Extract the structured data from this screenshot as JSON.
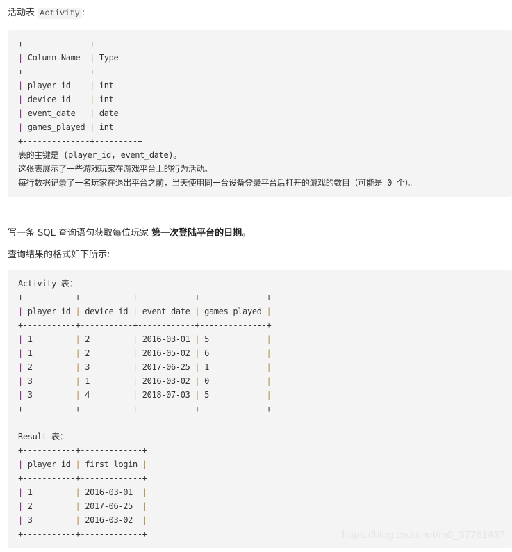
{
  "intro": {
    "label": "活动表",
    "table_name": "Activity",
    "suffix": ":"
  },
  "schema_block": {
    "border_top": "+--------------+---------+",
    "header": [
      "Column Name",
      "Type"
    ],
    "border_mid": "+--------------+---------+",
    "rows": [
      [
        "player_id",
        "int"
      ],
      [
        "device_id",
        "int"
      ],
      [
        "event_date",
        "date"
      ],
      [
        "games_played",
        "int"
      ]
    ],
    "border_bottom": "+--------------+---------+",
    "notes": [
      "表的主键是 (player_id, event_date)。",
      "这张表展示了一些游戏玩家在游戏平台上的行为活动。",
      "每行数据记录了一名玩家在退出平台之前，当天使用同一台设备登录平台后打开的游戏的数目（可能是 0 个）。"
    ]
  },
  "question": {
    "prefix": "写一条 SQL 查询语句获取每位玩家 ",
    "bold": "第一次登陆平台的日期。"
  },
  "format_label": "查询结果的格式如下所示:",
  "example_block": {
    "activity_title": "Activity 表：",
    "activity_border": "+-----------+-----------+------------+--------------+",
    "activity_header": [
      "player_id",
      "device_id",
      "event_date",
      "games_played"
    ],
    "activity_rows": [
      [
        "1",
        "2",
        "2016-03-01",
        "5"
      ],
      [
        "1",
        "2",
        "2016-05-02",
        "6"
      ],
      [
        "2",
        "3",
        "2017-06-25",
        "1"
      ],
      [
        "3",
        "1",
        "2016-03-02",
        "0"
      ],
      [
        "3",
        "4",
        "2018-07-03",
        "5"
      ]
    ],
    "result_title": "Result 表：",
    "result_border": "+-----------+-------------+",
    "result_header": [
      "player_id",
      "first_login"
    ],
    "result_rows": [
      [
        "1",
        "2016-03-01"
      ],
      [
        "2",
        "2017-06-25"
      ],
      [
        "3",
        "2016-03-02"
      ]
    ]
  },
  "watermark": "https://blog.csdn.net/m0_37761437"
}
